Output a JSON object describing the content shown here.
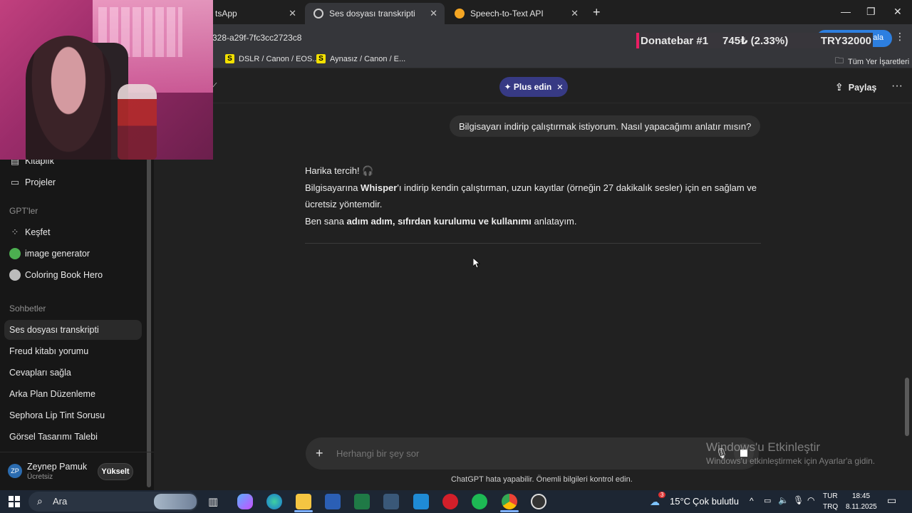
{
  "browser": {
    "tabs": [
      {
        "label": "tsApp"
      },
      {
        "label": "Ses dosyası transkripti"
      },
      {
        "label": "Speech-to-Text API"
      }
    ],
    "url_fragment": "328-a29f-7fc3cc2723c8",
    "url_suffix": "amala",
    "bookmarks": [
      {
        "label": "DSLR / Canon / EOS..."
      },
      {
        "label": "Aynasız / Canon / E..."
      }
    ],
    "all_bookmarks_label": "Tüm Yer İşaretleri"
  },
  "donatebar": {
    "label": "Donatebar #1",
    "amount": "745₺ (2.33%)",
    "goal": "TRY32000",
    "progress_percent": 2.33
  },
  "sidebar": {
    "items_top": [
      {
        "label": "Kitaplık"
      },
      {
        "label": "Projeler"
      }
    ],
    "gpts_heading": "GPT'ler",
    "gpts": [
      {
        "label": "Keşfet"
      },
      {
        "label": "image generator"
      },
      {
        "label": "Coloring Book Hero"
      }
    ],
    "chats_heading": "Sohbetler",
    "chats": [
      {
        "label": "Ses dosyası transkripti"
      },
      {
        "label": "Freud kitabı yorumu"
      },
      {
        "label": "Cevapları sağla"
      },
      {
        "label": "Arka Plan Düzenleme"
      },
      {
        "label": "Sephora Lip Tint Sorusu"
      },
      {
        "label": "Görsel Tasarımı Talebi"
      }
    ],
    "user": {
      "initials": "ZP",
      "name": "Zeynep Pamuk",
      "plan": "Ücretsiz",
      "upgrade_label": "Yükselt"
    }
  },
  "header": {
    "plus_label": "✦ Plus edin",
    "share_label": "Paylaş"
  },
  "conversation": {
    "user_message": "Bilgisayarı indirip çalıştırmak istiyorum. Nasıl yapacağımı anlatır mısın?",
    "assistant": {
      "line1": "Harika tercih! 🎧",
      "line2_a": "Bilgisayarına ",
      "line2_b": "Whisper",
      "line2_c": "'ı indirip kendin çalıştırman, uzun kayıtlar (örneğin 27 dakikalık sesler) için en sağlam ve ücretsiz yöntemdir.",
      "line3_a": "Ben sana ",
      "line3_b": "adım adım, sıfırdan kurulumu ve kullanımı",
      "line3_c": " anlatayım."
    }
  },
  "composer": {
    "placeholder": "Herhangi bir şey sor"
  },
  "disclaimer": "ChatGPT hata yapabilir. Önemli bilgileri kontrol edin.",
  "watermark": {
    "title": "Windows'u Etkinleştir",
    "subtitle": "Windows'u etkinleştirmek için Ayarlar'a gidin."
  },
  "taskbar": {
    "search_label": "Ara",
    "weather_temp": "15°C",
    "weather_desc": "Çok bulutlu",
    "weather_badge": "3",
    "lang": "TUR",
    "layout": "TRQ",
    "time": "18:45",
    "date": "8.11.2025"
  }
}
